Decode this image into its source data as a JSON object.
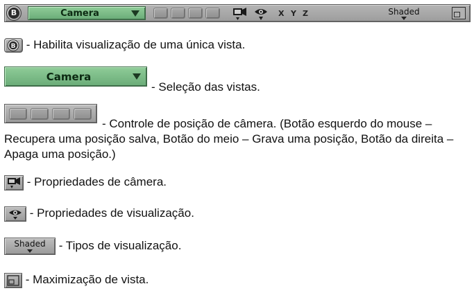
{
  "toolbar": {
    "single_view_letter": "B",
    "view_select_label": "Camera",
    "axes": [
      "X",
      "Y",
      "Z"
    ],
    "shading_label": "Shaded",
    "colors": {
      "toolbar_bg": "#a7a7a7",
      "view_select_bg": "#7cbd88"
    }
  },
  "legend": {
    "single_view": "- Habilita visualização de uma única vista.",
    "view_select": "- Seleção das vistas.",
    "camera_position": "- Controle de posição de câmera. (Botão esquerdo do mouse – Recupera uma posição salva, Botão do meio – Grava uma posição, Botão da direita – Apaga uma posição.)",
    "camera_props": "- Propriedades de câmera.",
    "view_props": "- Propriedades de visualização.",
    "shading_types": "- Tipos de visualização.",
    "maximize": "- Maximização de vista."
  },
  "icons": [
    "b-circle-icon",
    "dropdown-arrow-icon",
    "camera-icon",
    "eye-icon",
    "maximize-icon"
  ]
}
